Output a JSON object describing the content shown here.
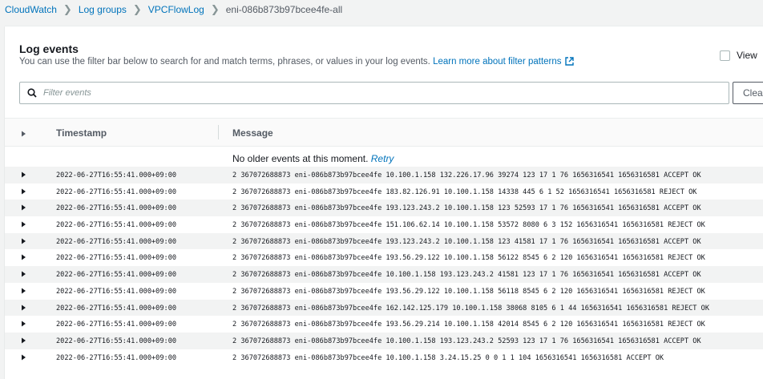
{
  "breadcrumb": {
    "items": [
      "CloudWatch",
      "Log groups",
      "VPCFlowLog"
    ],
    "current": "eni-086b873b97bcee4fe-all"
  },
  "panel": {
    "title": "Log events",
    "description": "You can use the filter bar below to search for and match terms, phrases, or values in your log events.",
    "learn_more": "Learn more about filter patterns",
    "view_label": "View",
    "filter_placeholder": "Filter events",
    "clear_label": "Clea"
  },
  "table": {
    "headers": {
      "timestamp": "Timestamp",
      "message": "Message"
    },
    "no_older": "No older events at this moment.",
    "retry": "Retry",
    "rows": [
      {
        "timestamp": "2022-06-27T16:55:41.000+09:00",
        "message": "2 367072688873 eni-086b873b97bcee4fe 10.100.1.158 132.226.17.96 39274 123 17 1 76 1656316541 1656316581 ACCEPT OK"
      },
      {
        "timestamp": "2022-06-27T16:55:41.000+09:00",
        "message": "2 367072688873 eni-086b873b97bcee4fe 183.82.126.91 10.100.1.158 14338 445 6 1 52 1656316541 1656316581 REJECT OK"
      },
      {
        "timestamp": "2022-06-27T16:55:41.000+09:00",
        "message": "2 367072688873 eni-086b873b97bcee4fe 193.123.243.2 10.100.1.158 123 52593 17 1 76 1656316541 1656316581 ACCEPT OK"
      },
      {
        "timestamp": "2022-06-27T16:55:41.000+09:00",
        "message": "2 367072688873 eni-086b873b97bcee4fe 151.106.62.14 10.100.1.158 53572 8080 6 3 152 1656316541 1656316581 REJECT OK"
      },
      {
        "timestamp": "2022-06-27T16:55:41.000+09:00",
        "message": "2 367072688873 eni-086b873b97bcee4fe 193.123.243.2 10.100.1.158 123 41581 17 1 76 1656316541 1656316581 ACCEPT OK"
      },
      {
        "timestamp": "2022-06-27T16:55:41.000+09:00",
        "message": "2 367072688873 eni-086b873b97bcee4fe 193.56.29.122 10.100.1.158 56122 8545 6 2 120 1656316541 1656316581 REJECT OK"
      },
      {
        "timestamp": "2022-06-27T16:55:41.000+09:00",
        "message": "2 367072688873 eni-086b873b97bcee4fe 10.100.1.158 193.123.243.2 41581 123 17 1 76 1656316541 1656316581 ACCEPT OK"
      },
      {
        "timestamp": "2022-06-27T16:55:41.000+09:00",
        "message": "2 367072688873 eni-086b873b97bcee4fe 193.56.29.122 10.100.1.158 56118 8545 6 2 120 1656316541 1656316581 REJECT OK"
      },
      {
        "timestamp": "2022-06-27T16:55:41.000+09:00",
        "message": "2 367072688873 eni-086b873b97bcee4fe 162.142.125.179 10.100.1.158 38068 8105 6 1 44 1656316541 1656316581 REJECT OK"
      },
      {
        "timestamp": "2022-06-27T16:55:41.000+09:00",
        "message": "2 367072688873 eni-086b873b97bcee4fe 193.56.29.214 10.100.1.158 42014 8545 6 2 120 1656316541 1656316581 REJECT OK"
      },
      {
        "timestamp": "2022-06-27T16:55:41.000+09:00",
        "message": "2 367072688873 eni-086b873b97bcee4fe 10.100.1.158 193.123.243.2 52593 123 17 1 76 1656316541 1656316581 ACCEPT OK"
      },
      {
        "timestamp": "2022-06-27T16:55:41.000+09:00",
        "message": "2 367072688873 eni-086b873b97bcee4fe 10.100.1.158 3.24.15.25 0 0 1 1 104 1656316541 1656316581 ACCEPT OK"
      }
    ]
  },
  "colors": {
    "link": "#0073bb",
    "text": "#16191f",
    "muted": "#545b64",
    "background": "#f2f3f3"
  },
  "icons": {
    "search": "search-icon",
    "external": "external-link-icon",
    "expand": "caret-right-icon"
  }
}
